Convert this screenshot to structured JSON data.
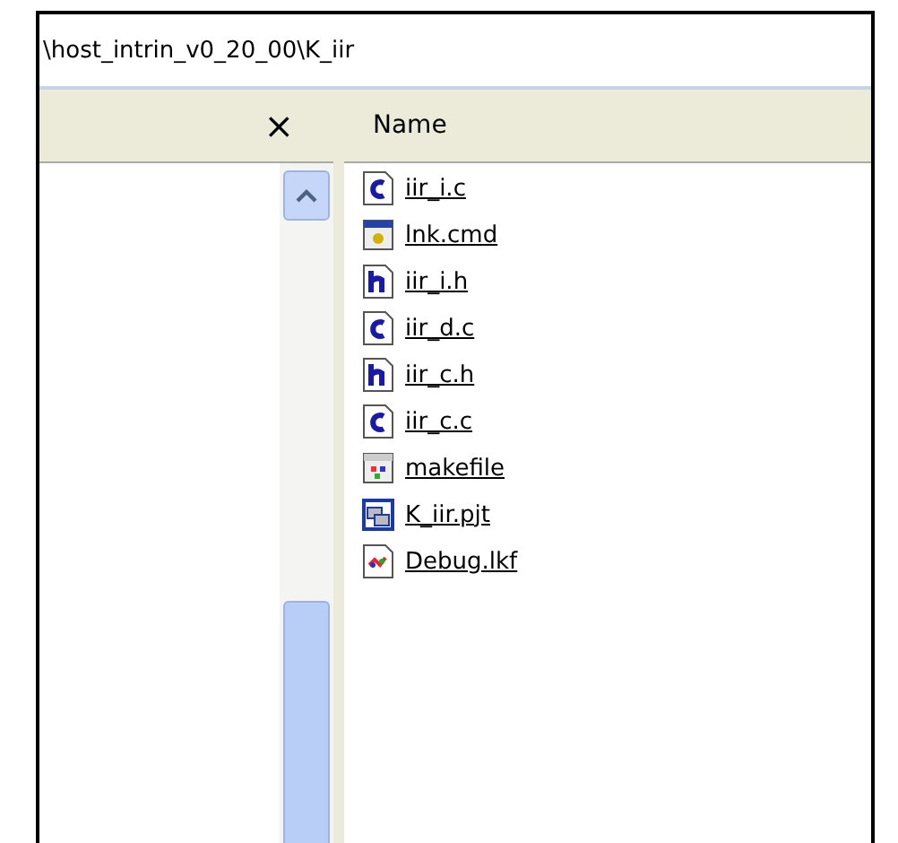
{
  "address_bar": {
    "path": "\\host_intrin_v0_20_00\\K_iir"
  },
  "folders_pane": {
    "close_label": "×"
  },
  "file_list": {
    "columns": [
      "Name"
    ],
    "files": [
      {
        "name": "iir_i.c",
        "kind": "c"
      },
      {
        "name": "lnk.cmd",
        "kind": "cmd"
      },
      {
        "name": "iir_i.h",
        "kind": "h"
      },
      {
        "name": "iir_d.c",
        "kind": "c"
      },
      {
        "name": "iir_c.h",
        "kind": "h"
      },
      {
        "name": "iir_c.c",
        "kind": "c"
      },
      {
        "name": "makefile",
        "kind": "makefile"
      },
      {
        "name": "K_iir.pjt",
        "kind": "pjt"
      },
      {
        "name": "Debug.lkf",
        "kind": "lkf"
      }
    ]
  }
}
